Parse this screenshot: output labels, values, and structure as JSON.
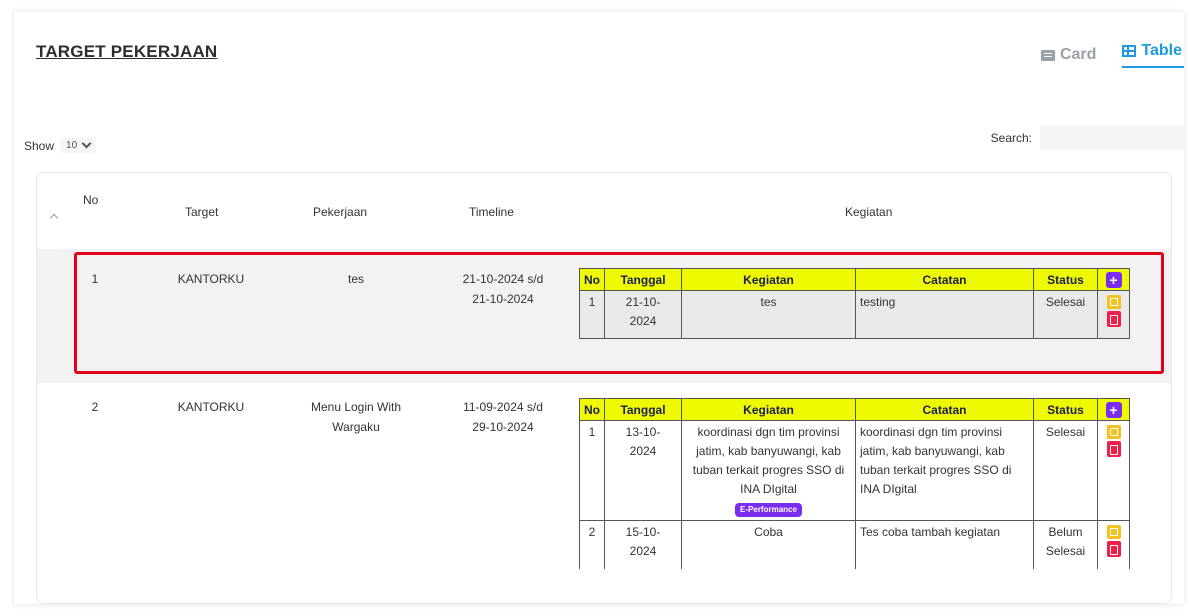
{
  "header": {
    "title": "TARGET PEKERJAAN",
    "view_card": "Card",
    "view_table": "Table"
  },
  "controls": {
    "show_label": "Show",
    "show_value": "10",
    "search_label": "Search:",
    "search_value": ""
  },
  "table": {
    "columns": [
      "No",
      "Target",
      "Pekerjaan",
      "Timeline",
      "Kegiatan"
    ],
    "sub_columns": [
      "No",
      "Tanggal",
      "Kegiatan",
      "Catatan",
      "Status"
    ],
    "rows": [
      {
        "no": "1",
        "target": "KANTORKU",
        "pekerjaan": "tes",
        "timeline_start": "21-10-2024 s/d",
        "timeline_end": "21-10-2024",
        "kegiatan": [
          {
            "no": "1",
            "tanggal": "21-10-2024",
            "kegiatan": "tes",
            "catatan": "testing",
            "status": "Selesai",
            "badge": ""
          }
        ]
      },
      {
        "no": "2",
        "target": "KANTORKU",
        "pekerjaan": "Menu Login With Wargaku",
        "timeline_start": "11-09-2024 s/d",
        "timeline_end": "29-10-2024",
        "kegiatan": [
          {
            "no": "1",
            "tanggal": "13-10-2024",
            "kegiatan": "koordinasi dgn tim provinsi jatim, kab banyuwangi, kab tuban terkait progres SSO di INA DIgital",
            "catatan": "koordinasi dgn tim provinsi jatim, kab banyuwangi, kab tuban terkait progres SSO di INA DIgital",
            "status": "Selesai",
            "badge": "E-Performance"
          },
          {
            "no": "2",
            "tanggal": "15-10-2024",
            "kegiatan": "Coba",
            "catatan": "Tes coba tambah kegiatan",
            "status": "Belum Selesai",
            "badge": ""
          }
        ]
      }
    ]
  },
  "colors": {
    "accent": "#1e9be0",
    "subheader_bg": "#eefb00",
    "add_button": "#7a2cf0",
    "edit_button": "#f3c21f",
    "delete_button": "#ef1f4a",
    "highlight_border": "#e0001b"
  },
  "icons": [
    "card-icon",
    "table-icon",
    "chevron-down-icon",
    "sort-icon",
    "plus-icon",
    "edit-icon",
    "trash-icon"
  ]
}
